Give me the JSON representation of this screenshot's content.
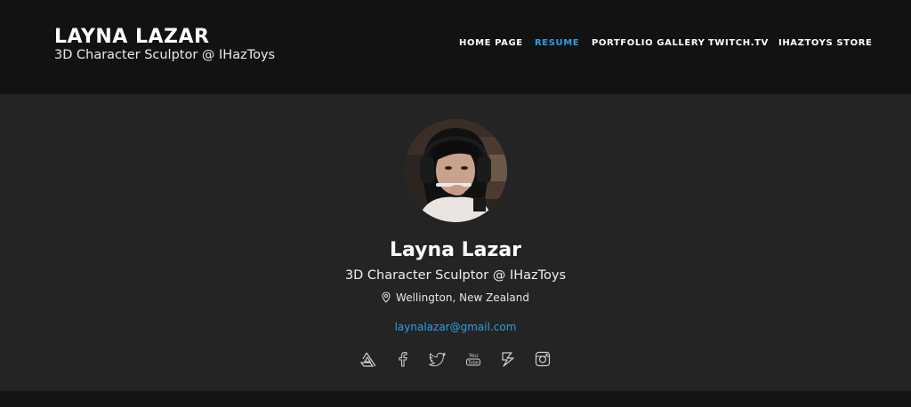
{
  "header": {
    "brand_name": "LAYNA LAZAR",
    "brand_subtitle": "3D Character Sculptor @ IHazToys"
  },
  "nav": {
    "items": [
      {
        "label": "HOME PAGE",
        "active": false
      },
      {
        "label": "RESUME",
        "active": true
      },
      {
        "label": "PORTFOLIO GALLERY",
        "active": false
      },
      {
        "label": "TWITCH.TV",
        "active": false
      },
      {
        "label": "IHAZTOYS STORE",
        "active": false
      }
    ]
  },
  "profile": {
    "name": "Layna Lazar",
    "title": "3D Character Sculptor @ IHazToys",
    "location": "Wellington, New Zealand",
    "email": "laynalazar@gmail.com",
    "socials": [
      "artstation-icon",
      "facebook-icon",
      "twitter-icon",
      "youtube-icon",
      "zbrush-icon",
      "instagram-icon"
    ]
  },
  "colors": {
    "accent": "#2e9fe6",
    "header_bg": "#121212",
    "main_bg": "#242424"
  }
}
